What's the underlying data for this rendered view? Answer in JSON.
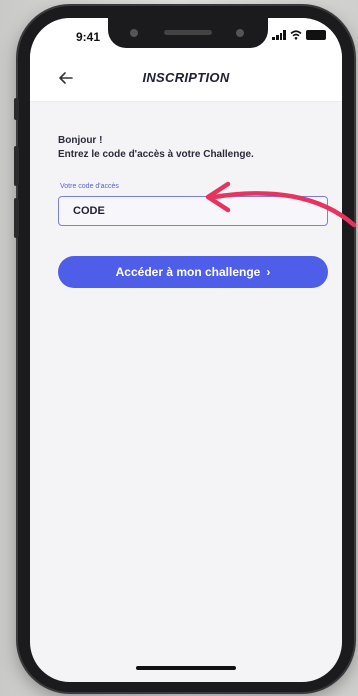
{
  "status_bar": {
    "time": "9:41"
  },
  "header": {
    "title": "INSCRIPTION"
  },
  "greeting": {
    "line1": "Bonjour !",
    "line2": "Entrez le code d'accès à votre Challenge."
  },
  "form": {
    "field_label": "Votre code d'accès",
    "code_value": "CODE"
  },
  "cta": {
    "label": "Accéder à mon challenge",
    "chevron": "›"
  },
  "colors": {
    "accent": "#4f5ee8",
    "annotation": "#e6345f",
    "field_border": "#7d7fe0"
  }
}
